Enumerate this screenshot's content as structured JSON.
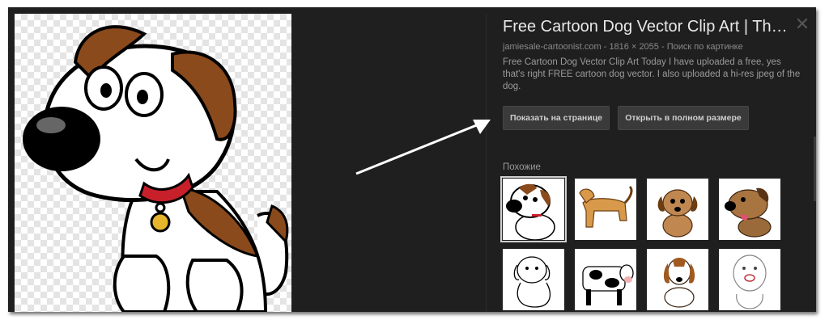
{
  "detail": {
    "title": "Free Cartoon Dog Vector Clip Art | Th…",
    "source": "jamiesale-cartoonist.com",
    "separator": " - ",
    "dimensions": "1816 × 2055",
    "separator2": " - ",
    "search_by_image": "Поиск по картинке",
    "description": "Free Cartoon Dog Vector Clip Art Today I have uploaded a free, yes that's right FREE cartoon dog vector. I also uploaded a hi-res jpeg of the dog.",
    "show_on_page_button": "Показать на странице",
    "open_full_size_button": "Открыть в полном размере",
    "close_glyph": "✕",
    "similar_label": "Похожие"
  },
  "thumbs": [
    {
      "name": "thumb-cartoon-dog-sitting",
      "selected": true
    },
    {
      "name": "thumb-tan-dog-standing"
    },
    {
      "name": "thumb-brown-puppy"
    },
    {
      "name": "thumb-dog-tongue-out"
    },
    {
      "name": "thumb-dog-outline"
    },
    {
      "name": "thumb-spotted-cow"
    },
    {
      "name": "thumb-beagle"
    },
    {
      "name": "thumb-cartoon-outline-face"
    }
  ],
  "colors": {
    "background": "#1f1f1f",
    "title": "#e8e8e8",
    "meta": "#8a8a8a",
    "button_bg": "#3a3a3a"
  }
}
